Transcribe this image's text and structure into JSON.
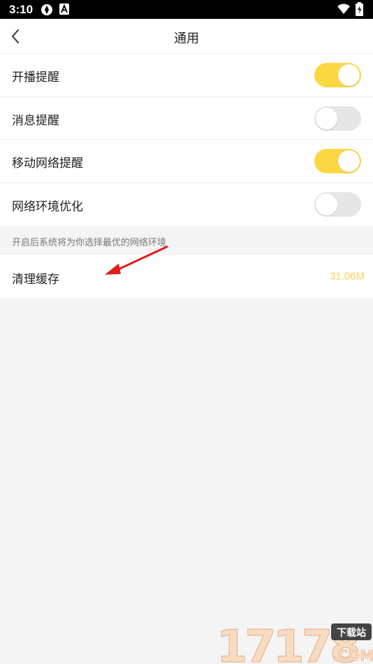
{
  "status_bar": {
    "time": "3:10"
  },
  "header": {
    "title": "通用"
  },
  "settings": [
    {
      "label": "开播提醒",
      "on": true
    },
    {
      "label": "消息提醒",
      "on": false
    },
    {
      "label": "移动网络提醒",
      "on": true
    },
    {
      "label": "网络环境优化",
      "on": false
    }
  ],
  "hint": "开启后系统将为你选择最优的网络环境",
  "cache": {
    "label": "清理缓存",
    "size": "31.06M"
  },
  "watermark": {
    "main": "17178",
    "badge": "下载站",
    "sub": ".COM"
  },
  "colors": {
    "accent": "#fcd744",
    "cache_size": "#f6d25a",
    "annotation_arrow": "#e11c1c"
  }
}
